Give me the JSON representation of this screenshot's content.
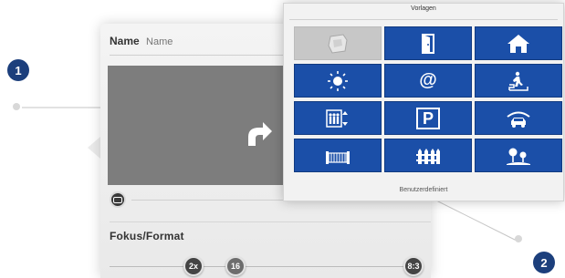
{
  "editor": {
    "name_label": "Name",
    "name_placeholder": "Name",
    "fokus_label": "Fokus/Format",
    "zoom_buttons": [
      "2x",
      "16",
      "8:3"
    ]
  },
  "templates_popup": {
    "title": "Vorlagen",
    "footer": "Benutzerdefiniert",
    "tiles": [
      {
        "icon": "custom-image-icon",
        "disabled": true
      },
      {
        "icon": "door-icon"
      },
      {
        "icon": "house-icon"
      },
      {
        "icon": "sun-icon"
      },
      {
        "icon": "at-sign-icon",
        "text": "@"
      },
      {
        "icon": "stairs-person-icon"
      },
      {
        "icon": "elevator-people-icon"
      },
      {
        "icon": "parking-icon",
        "text": "P"
      },
      {
        "icon": "garage-car-icon"
      },
      {
        "icon": "gate-icon"
      },
      {
        "icon": "fence-icon"
      },
      {
        "icon": "garden-trees-icon"
      }
    ]
  },
  "callouts": [
    "1",
    "2"
  ],
  "colors": {
    "tile_blue": "#1b4fa8",
    "callout_navy": "#1c3f7c",
    "preview_gray": "#7d7d7d"
  }
}
